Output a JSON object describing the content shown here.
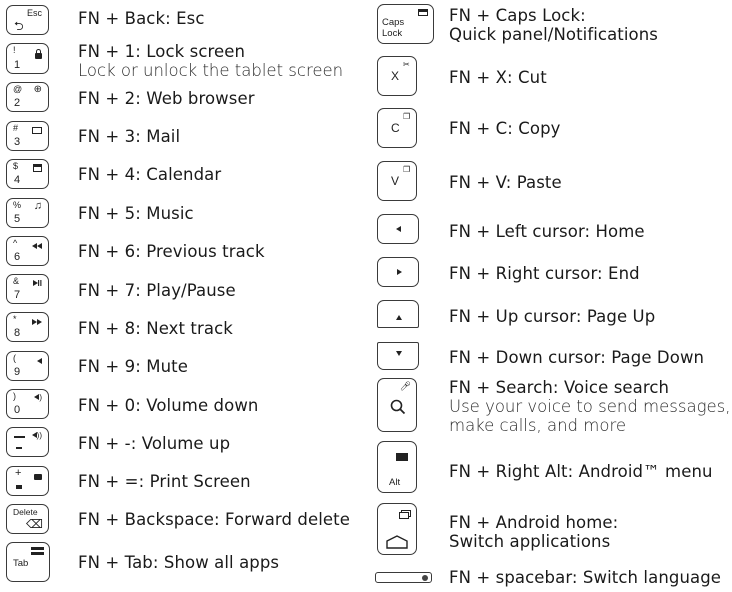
{
  "left_column": [
    {
      "key": {
        "top": "Esc",
        "bottom_icon": "back-arrow"
      },
      "title": "FN + Back: Esc"
    },
    {
      "key": {
        "top": "!",
        "bottom": "1",
        "icon": "lock"
      },
      "title": "FN + 1: Lock screen",
      "subtitle": "Lock or unlock the tablet screen"
    },
    {
      "key": {
        "top": "@",
        "bottom": "2",
        "icon": "globe"
      },
      "title": "FN + 2: Web browser"
    },
    {
      "key": {
        "top": "#",
        "bottom": "3",
        "icon": "mail"
      },
      "title": "FN + 3: Mail"
    },
    {
      "key": {
        "top": "$",
        "bottom": "4",
        "icon": "calendar"
      },
      "title": "FN + 4: Calendar"
    },
    {
      "key": {
        "top": "%",
        "bottom": "5",
        "icon": "music"
      },
      "title": "FN + 5: Music"
    },
    {
      "key": {
        "top": "^",
        "bottom": "6",
        "icon": "previous-track"
      },
      "title": "FN + 6: Previous track"
    },
    {
      "key": {
        "top": "&",
        "bottom": "7",
        "icon": "play-pause"
      },
      "title": "FN + 7: Play/Pause"
    },
    {
      "key": {
        "top": "*",
        "bottom": "8",
        "icon": "next-track"
      },
      "title": "FN + 8: Next track"
    },
    {
      "key": {
        "top": "(",
        "bottom": "9",
        "icon": "mute"
      },
      "title": "FN + 9: Mute"
    },
    {
      "key": {
        "top": ")",
        "bottom": "0",
        "icon": "volume-down"
      },
      "title": "FN + 0: Volume down"
    },
    {
      "key": {
        "top": "_",
        "bottom": "-",
        "icon": "volume-up"
      },
      "title": "FN + -: Volume up"
    },
    {
      "key": {
        "top": "+",
        "bottom": "=",
        "icon": "camera"
      },
      "title": "FN + =: Print Screen"
    },
    {
      "key": {
        "top": "Delete",
        "bottom_icon": "backspace"
      },
      "title": "FN + Backspace: Forward delete"
    },
    {
      "key": {
        "label": "Tab",
        "icon": "all-apps"
      },
      "title": "FN + Tab: Show all apps"
    }
  ],
  "right_column": [
    {
      "key": {
        "label": "Caps Lock",
        "icon": "notifications"
      },
      "title": "FN + Caps Lock:",
      "title2": "Quick panel/Notifications"
    },
    {
      "key": {
        "label": "X",
        "icon": "scissors"
      },
      "title": "FN + X: Cut"
    },
    {
      "key": {
        "label": "C",
        "icon": "copy"
      },
      "title": "FN + C: Copy"
    },
    {
      "key": {
        "label": "V",
        "icon": "paste"
      },
      "title": "FN + V: Paste"
    },
    {
      "key": {
        "icon": "left-arrow"
      },
      "title": "FN + Left cursor: Home"
    },
    {
      "key": {
        "icon": "right-arrow"
      },
      "title": "FN + Right cursor: End"
    },
    {
      "key": {
        "icon": "up-arrow"
      },
      "title": "FN + Up cursor: Page Up"
    },
    {
      "key": {
        "icon": "down-arrow"
      },
      "title": "FN + Down cursor: Page Down"
    },
    {
      "key": {
        "icon": "search",
        "icon2": "microphone"
      },
      "title": "FN + Search: Voice search",
      "subtitle": "Use your voice to send messages,",
      "subtitle2": "make calls, and more"
    },
    {
      "key": {
        "label": "Alt",
        "icon": "menu"
      },
      "title": "FN + Right Alt: Android™ menu"
    },
    {
      "key": {
        "icon": "home",
        "icon2": "recent-apps"
      },
      "title": "FN + Android home:",
      "title2": "Switch applications"
    },
    {
      "key": {
        "icon": "globe-dot"
      },
      "title": "FN + spacebar: Switch language"
    }
  ],
  "glyphs": {
    "back": "⮌",
    "globe": "⊕",
    "music": "♫",
    "prev": "◀◀",
    "playpause": "▶II",
    "next": "▶▶",
    "mute": "◂",
    "voldown": "◂)",
    "volup": "◂))",
    "backspace": "⌫",
    "scissors": "✂",
    "copy": "❐",
    "paste": "❐",
    "search": "⚲",
    "mic": "↓",
    "recent": "❐",
    "home": "⌂"
  }
}
